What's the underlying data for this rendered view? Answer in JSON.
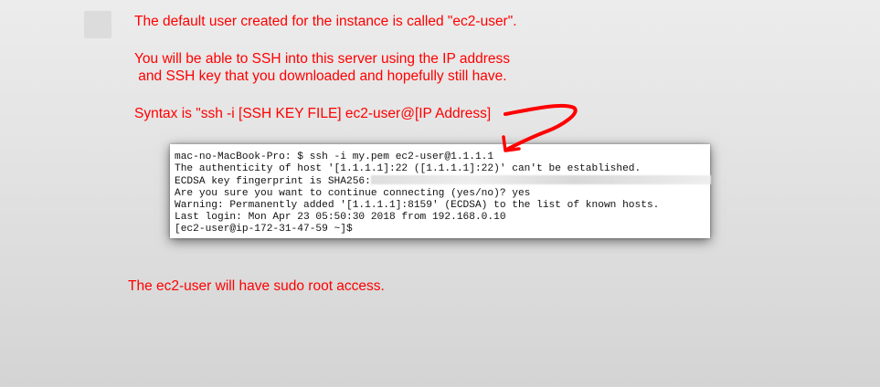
{
  "notes": {
    "default_user": "The default user created for the instance is called \"ec2-user\".",
    "ssh_line1": "You will be able to SSH into this server using the IP address",
    "ssh_line2": " and SSH key that you downloaded and hopefully still have.",
    "syntax": "Syntax is \"ssh -i [SSH KEY FILE] ec2-user@[IP Address]",
    "sudo": "The ec2-user will have sudo root access."
  },
  "terminal": {
    "line1": "mac-no-MacBook-Pro: $ ssh -i my.pem ec2-user@1.1.1.1",
    "line2": "The authenticity of host '[1.1.1.1]:22 ([1.1.1.1]:22)' can't be established.",
    "line3_prefix": "ECDSA key fingerprint is SHA256:",
    "line4": "Are you sure you want to continue connecting (yes/no)? yes",
    "line5": "Warning: Permanently added '[1.1.1.1]:8159' (ECDSA) to the list of known hosts.",
    "line6": "Last login: Mon Apr 23 05:50:30 2018 from 192.168.0.10",
    "line7": "[ec2-user@ip-172-31-47-59 ~]$"
  },
  "colors": {
    "annotation": "#ff0000",
    "terminal_bg": "#ffffff",
    "page_bg": "#e4e4e4"
  },
  "icons": {
    "arrow": "hand-drawn-red-arrow"
  }
}
